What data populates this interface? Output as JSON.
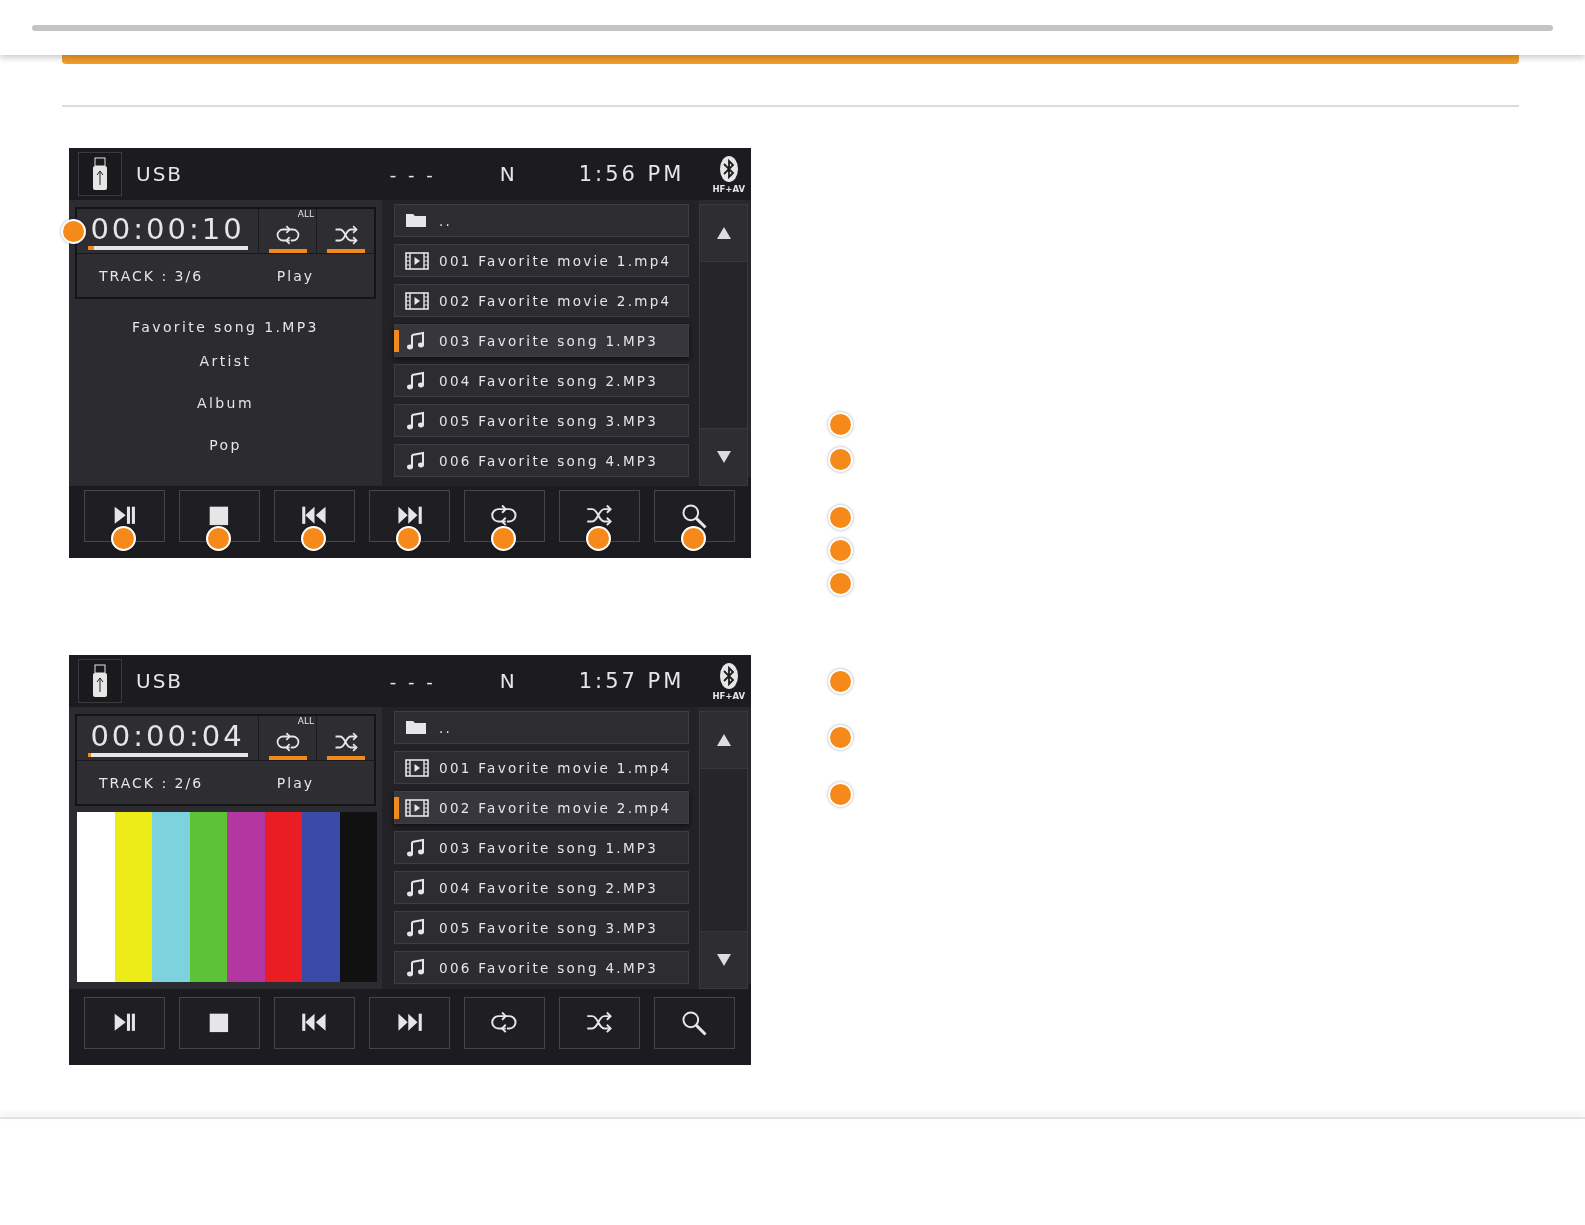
{
  "screens": [
    {
      "kind": "info",
      "source": "USB",
      "status": "- - -",
      "gear": "N",
      "time": "1:56 PM",
      "badge": "HF+AV",
      "timer": "00:00:10",
      "level": 0.04,
      "timer_callout": true,
      "repeat_label": "ALL",
      "repeat_on": true,
      "shuffle_on": true,
      "track": "TRACK : 3/6",
      "state": "Play",
      "info": [
        "Favorite song 1.MP3",
        "Artist",
        "Album",
        "Pop"
      ],
      "files": [
        {
          "kind": "folder",
          "name": "..",
          "selected": false
        },
        {
          "kind": "movie",
          "name": "001 Favorite movie 1.mp4",
          "selected": false
        },
        {
          "kind": "movie",
          "name": "002 Favorite movie 2.mp4",
          "selected": false
        },
        {
          "kind": "song",
          "name": "003 Favorite song 1.MP3",
          "selected": true
        },
        {
          "kind": "song",
          "name": "004 Favorite song 2.MP3",
          "selected": false
        },
        {
          "kind": "song",
          "name": "005 Favorite song 3.MP3",
          "selected": false
        },
        {
          "kind": "song",
          "name": "006 Favorite song 4.MP3",
          "selected": false
        }
      ],
      "controls": [
        {
          "kind": "playpause",
          "callout": true
        },
        {
          "kind": "stop",
          "callout": true
        },
        {
          "kind": "prev",
          "callout": true
        },
        {
          "kind": "next",
          "callout": true
        },
        {
          "kind": "repeat",
          "callout": true
        },
        {
          "kind": "shuffle",
          "callout": true
        },
        {
          "kind": "search",
          "callout": true
        }
      ]
    },
    {
      "kind": "video",
      "source": "USB",
      "status": "- - -",
      "gear": "N",
      "time": "1:57 PM",
      "badge": "HF+AV",
      "timer": "00:00:04",
      "level": 0.02,
      "timer_callout": false,
      "repeat_label": "ALL",
      "repeat_on": true,
      "shuffle_on": true,
      "track": "TRACK : 2/6",
      "state": "Play",
      "files": [
        {
          "kind": "folder",
          "name": "..",
          "selected": false
        },
        {
          "kind": "movie",
          "name": "001 Favorite movie 1.mp4",
          "selected": false
        },
        {
          "kind": "movie",
          "name": "002 Favorite movie 2.mp4",
          "selected": true
        },
        {
          "kind": "song",
          "name": "003 Favorite song 1.MP3",
          "selected": false
        },
        {
          "kind": "song",
          "name": "004 Favorite song 2.MP3",
          "selected": false
        },
        {
          "kind": "song",
          "name": "005 Favorite song 3.MP3",
          "selected": false
        },
        {
          "kind": "song",
          "name": "006 Favorite song 4.MP3",
          "selected": false
        }
      ],
      "controls": [
        {
          "kind": "playpause",
          "callout": false
        },
        {
          "kind": "stop",
          "callout": false
        },
        {
          "kind": "prev",
          "callout": false
        },
        {
          "kind": "next",
          "callout": false
        },
        {
          "kind": "repeat",
          "callout": false
        },
        {
          "kind": "shuffle",
          "callout": false
        },
        {
          "kind": "search",
          "callout": false
        }
      ]
    }
  ]
}
